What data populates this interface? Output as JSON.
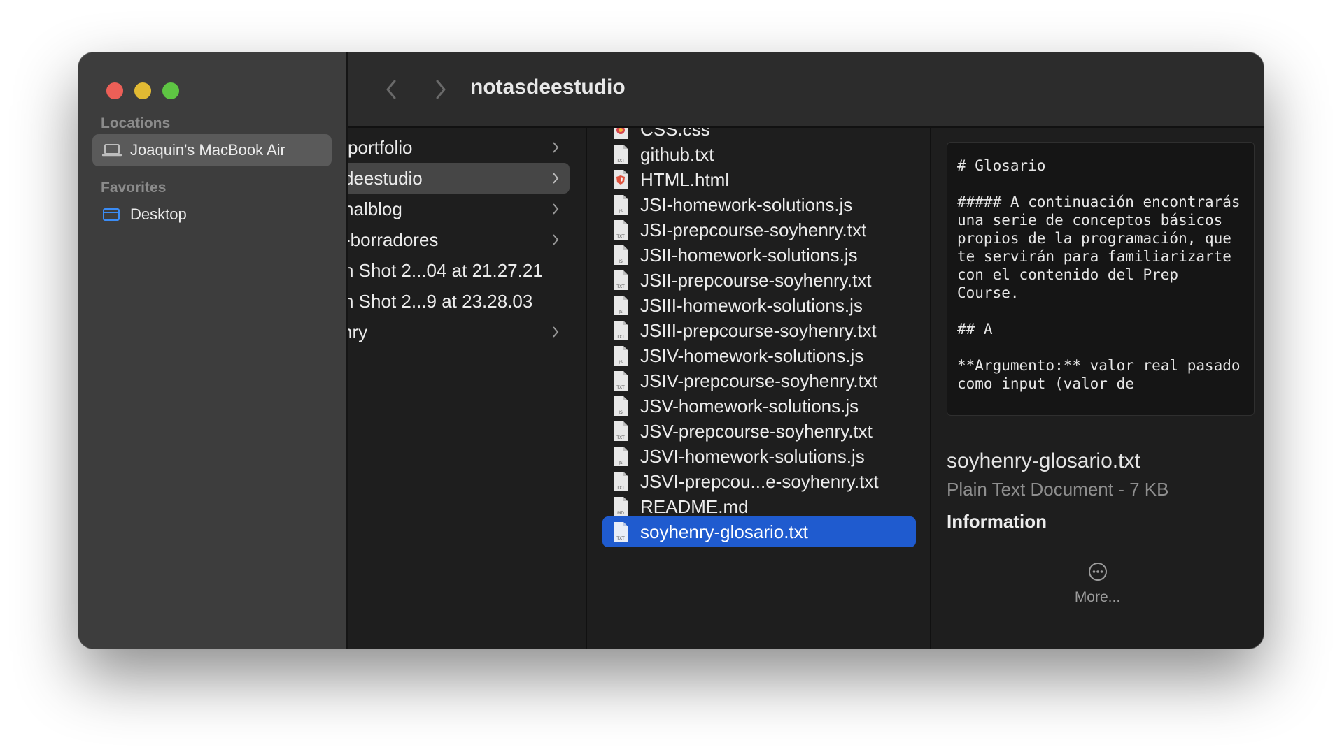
{
  "window": {
    "title": "notasdeestudio"
  },
  "sidebar": {
    "locations_heading": "Locations",
    "locations": [
      {
        "label": "Joaquin's MacBook Air",
        "icon": "laptop-icon",
        "selected": true
      }
    ],
    "favorites_heading": "Favorites",
    "favorites": [
      {
        "label": "Desktop",
        "icon": "desktop-folder-icon",
        "selected": false
      }
    ]
  },
  "columns": {
    "parent": [
      {
        "label": "portfolio",
        "has_children": true
      },
      {
        "label": "deestudio",
        "has_children": true,
        "selected": true
      },
      {
        "label": "nalblog",
        "has_children": true
      },
      {
        "label": "-borradores",
        "has_children": true
      },
      {
        "label": "n Shot 2...04 at 21.27.21",
        "has_children": false
      },
      {
        "label": "n Shot 2...9 at 23.28.03",
        "has_children": false
      },
      {
        "label": "nry",
        "has_children": true
      }
    ],
    "files": [
      {
        "label": "CSS.css",
        "icon": "css-file-icon",
        "type": "CSS"
      },
      {
        "label": "github.txt",
        "icon": "text-file-icon",
        "type": "TXT"
      },
      {
        "label": "HTML.html",
        "icon": "html-file-icon",
        "type": "HTML"
      },
      {
        "label": "JSI-homework-solutions.js",
        "icon": "js-file-icon",
        "type": "JS"
      },
      {
        "label": "JSI-prepcourse-soyhenry.txt",
        "icon": "text-file-icon",
        "type": "TXT"
      },
      {
        "label": "JSII-homework-solutions.js",
        "icon": "js-file-icon",
        "type": "JS"
      },
      {
        "label": "JSII-prepcourse-soyhenry.txt",
        "icon": "text-file-icon",
        "type": "TXT"
      },
      {
        "label": "JSIII-homework-solutions.js",
        "icon": "js-file-icon",
        "type": "JS"
      },
      {
        "label": "JSIII-prepcourse-soyhenry.txt",
        "icon": "text-file-icon",
        "type": "TXT"
      },
      {
        "label": "JSIV-homework-solutions.js",
        "icon": "js-file-icon",
        "type": "JS"
      },
      {
        "label": "JSIV-prepcourse-soyhenry.txt",
        "icon": "text-file-icon",
        "type": "TXT"
      },
      {
        "label": "JSV-homework-solutions.js",
        "icon": "js-file-icon",
        "type": "JS"
      },
      {
        "label": "JSV-prepcourse-soyhenry.txt",
        "icon": "text-file-icon",
        "type": "TXT"
      },
      {
        "label": "JSVI-homework-solutions.js",
        "icon": "js-file-icon",
        "type": "JS"
      },
      {
        "label": "JSVI-prepcou...e-soyhenry.txt",
        "icon": "text-file-icon",
        "type": "TXT"
      },
      {
        "label": "README.md",
        "icon": "markdown-file-icon",
        "type": "MD"
      },
      {
        "label": "soyhenry-glosario.txt",
        "icon": "text-file-icon",
        "type": "TXT",
        "selected": true
      }
    ]
  },
  "preview": {
    "content": "# Glosario\n\n##### A continuación encontrarás una serie de conceptos básicos propios de la programación, que te servirán para familiarizarte con el contenido del Prep Course.\n\n## A\n\n**Argumento:** valor real pasado como input (valor de",
    "file_name": "soyhenry-glosario.txt",
    "file_kind": "Plain Text Document - 7 KB",
    "info_heading": "Information",
    "more_label": "More..."
  },
  "colors": {
    "selection_blue": "#1f5bcf",
    "close": "#ec5f57",
    "minimize": "#e2ba33",
    "maximize": "#5ec543"
  }
}
